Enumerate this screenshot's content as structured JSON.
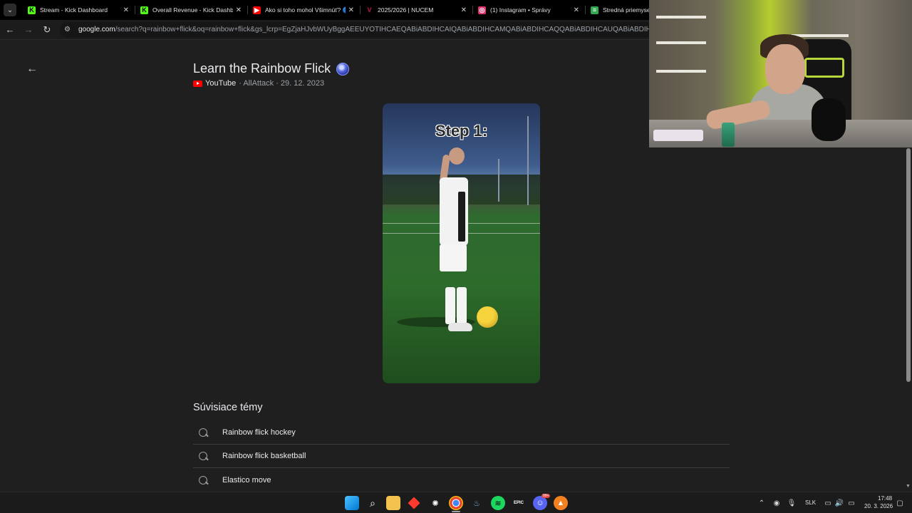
{
  "browser": {
    "tabs": [
      {
        "title": "Stream - Kick Dashboard",
        "favicon": "kick-icon",
        "color": "#53fc18"
      },
      {
        "title": "Overall Revenue - Kick Dashbo",
        "favicon": "kick-icon",
        "color": "#53fc18"
      },
      {
        "title": "Ako si toho mohol Všimnúť? 🔵",
        "favicon": "youtube-icon",
        "color": "#ff0000"
      },
      {
        "title": "2025/2026 | NUCEM",
        "favicon": "nucem-icon",
        "color": "#c2185b"
      },
      {
        "title": "(1) Instagram • Správy",
        "favicon": "instagram-icon",
        "color": "#e1306c"
      },
      {
        "title": "Stredná priemyselná",
        "favicon": "doc-icon",
        "color": "#34a853"
      }
    ],
    "url_host": "google.com",
    "url_rest": "/search?q=rainbow+flick&oq=rainbow+flick&gs_lcrp=EgZjaHJvbWUyBggAEEUYOTIHCAEQABiABDIHCAIQABiABDIHCAMQABiABDIHCAQQABiABDIHCAUQABiABDIHCAYQABiABDIHCAc"
  },
  "result": {
    "title": "Learn the Rainbow Flick",
    "source": "YouTube",
    "meta_rest": "· AllAttack · 29. 12. 2023",
    "video_caption": "Step 1:"
  },
  "related": {
    "heading": "Súvisiace témy",
    "items": [
      {
        "label": "Rainbow flick hockey"
      },
      {
        "label": "Rainbow flick basketball"
      },
      {
        "label": "Elastico move"
      }
    ]
  },
  "taskbar": {
    "language": "SLK",
    "time": "17:48",
    "date": "20. 3. 2026",
    "discord_badge": "99+"
  }
}
